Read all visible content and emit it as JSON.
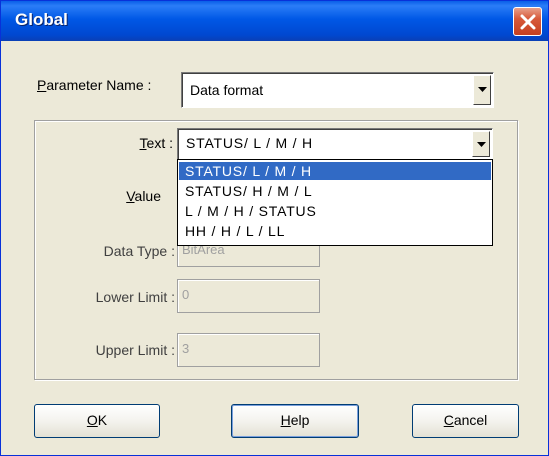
{
  "window": {
    "title": "Global"
  },
  "parameter": {
    "label_mnemonic": "P",
    "label_rest": "arameter Name :",
    "value": "Data format"
  },
  "text_field": {
    "label_mnemonic": "T",
    "label_rest": "ext :",
    "value": "STATUS/ L / M / H"
  },
  "dropdown": {
    "options": [
      "STATUS/ L / M / H",
      "STATUS/ H / M / L",
      "L / M / H / STATUS",
      "HH / H / L / LL"
    ],
    "selected_index": 0
  },
  "value_field": {
    "label_mnemonic": "V",
    "label_rest": "alue"
  },
  "data_type": {
    "label": "Data Type :",
    "value": "BitArea"
  },
  "lower_limit": {
    "label": "Lower Limit :",
    "value": "0"
  },
  "upper_limit": {
    "label": "Upper Limit :",
    "value": "3"
  },
  "buttons": {
    "ok_mnemonic": "O",
    "ok_rest": "K",
    "help_mnemonic": "H",
    "help_rest": "elp",
    "cancel_mnemonic": "C",
    "cancel_rest": "ancel"
  },
  "colors": {
    "titlebar": "#0058e6",
    "selection": "#316ac5",
    "face": "#ece9d8",
    "close": "#c6401f"
  },
  "icons": {
    "close": "close-icon",
    "dropdown_arrow": "chevron-down-icon"
  }
}
